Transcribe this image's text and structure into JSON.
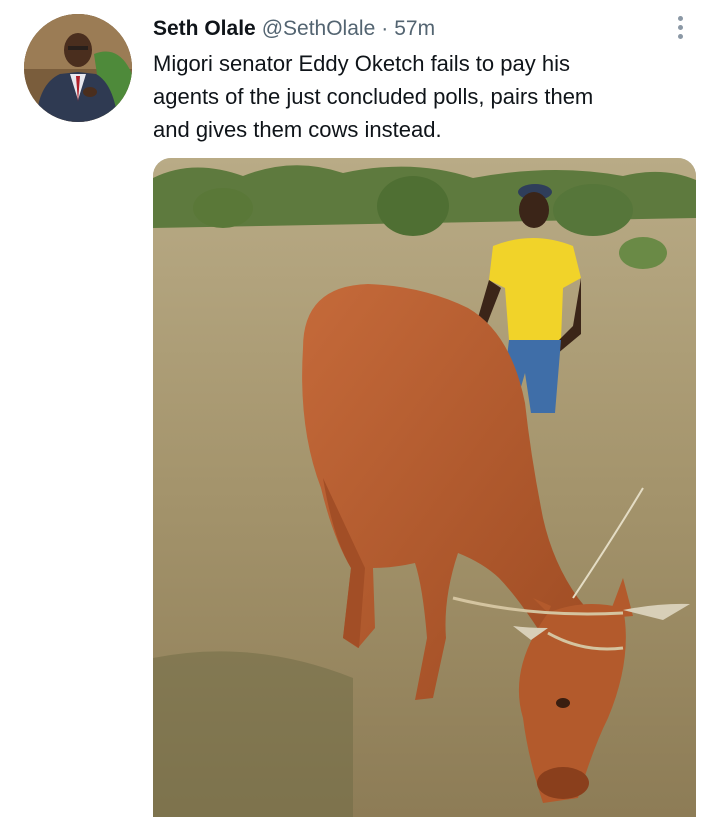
{
  "tweet": {
    "author_name": "Seth Olale",
    "handle": "@SethOlale",
    "separator": "·",
    "time": "57m",
    "text_lines": [
      "Migori senator Eddy Oketch fails to pay his",
      "agents of the just concluded polls, pairs them",
      "and gives them cows instead."
    ]
  },
  "icons": {
    "more": "more-vertical-icon",
    "avatar": "profile-photo",
    "media": "photo-man-with-cow"
  },
  "colors": {
    "text_primary": "#0f1419",
    "text_secondary": "#536471",
    "background": "#ffffff"
  }
}
